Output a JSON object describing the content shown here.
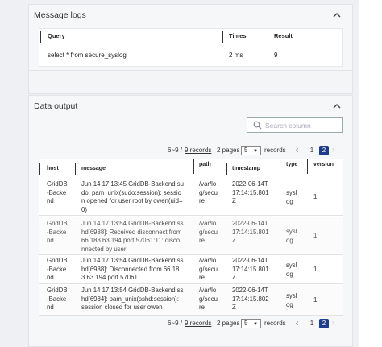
{
  "message_logs": {
    "title": "Message logs",
    "columns": {
      "query": "Query",
      "times": "Times",
      "result": "Result"
    },
    "rows": [
      {
        "query": "select * from secure_syslog",
        "times": "2 ms",
        "result": "9"
      }
    ]
  },
  "data_output": {
    "title": "Data output",
    "search": {
      "placeholder": "Search column"
    },
    "pager": {
      "range": "6~9 /",
      "records_link": "9 records",
      "pages_label": "2 pages",
      "page_size": "5",
      "records_label": "records",
      "pages": [
        "1",
        "2"
      ],
      "active_page": "2"
    },
    "columns": {
      "host": "host",
      "message": "message",
      "path": "path",
      "timestamp": "timestamp",
      "type": "type",
      "version": "version"
    },
    "rows": [
      {
        "host": "GridDB\n-Backe\nnd",
        "message": "Jun 14 17:13:45 GridDB-Backend su\ndo: pam_unix(sudo:session): sessio\nn opened for user root by owen(uid=\n0)",
        "path": "/var/lo\ng/secu\nre",
        "timestamp": "2022-06-14T\n17:14:15.801\nZ",
        "type": "sysl\nog",
        "version": "1"
      },
      {
        "host": "GridDB\n-Backe\nnd",
        "message": "Jun 14 17:13:54 GridDB-Backend ss\nhd[6988]: Received disconnect from\n66.183.63.194 port 57061:11: disco\nnnected by user",
        "path": "/var/lo\ng/secu\nre",
        "timestamp": "2022-06-14T\n17:14:15.801\nZ",
        "type": "sysl\nog",
        "version": "1"
      },
      {
        "host": "GridDB\n-Backe\nnd",
        "message": "Jun 14 17:13:54 GridDB-Backend ss\nhd[6988]: Disconnected from 66.18\n3.63.194 port 57061",
        "path": "/var/lo\ng/secu\nre",
        "timestamp": "2022-06-14T\n17:14:15.801\nZ",
        "type": "sysl\nog",
        "version": "1"
      },
      {
        "host": "GridDB\n-Backe\nnd",
        "message": "Jun 14 17:13:54 GridDB-Backend ss\nhd[6984]: pam_unix(sshd:session):\nsession closed for user owen",
        "path": "/var/lo\ng/secu\nre",
        "timestamp": "2022-06-14T\n17:14:15.802\nZ",
        "type": "sysl\nog",
        "version": "1"
      }
    ]
  }
}
